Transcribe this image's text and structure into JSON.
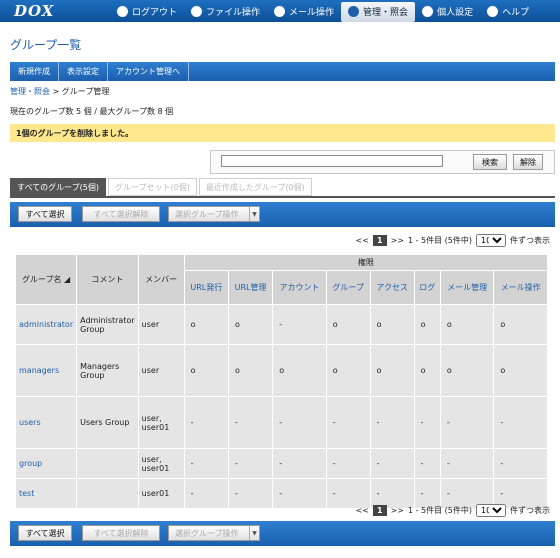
{
  "nav": {
    "logo": "DOX",
    "items": [
      {
        "label": "ログアウト",
        "icon": "logout-icon"
      },
      {
        "label": "ファイル操作",
        "icon": "file-icon"
      },
      {
        "label": "メール操作",
        "icon": "mail-icon"
      },
      {
        "label": "管理・照会",
        "icon": "admin-icon"
      },
      {
        "label": "個人設定",
        "icon": "user-icon"
      },
      {
        "label": "ヘルプ",
        "icon": "help-icon"
      }
    ],
    "active_index": 3
  },
  "page_title": "グループ一覧",
  "actions": [
    "新規作成",
    "表示設定",
    "アカウント管理へ"
  ],
  "breadcrumb": {
    "link": "管理・照会",
    "sep": " > ",
    "current": "グループ管理"
  },
  "count_line": "現在のグループ数 5 個 / 最大グループ数 8 個",
  "notice": "1個のグループを削除しました。",
  "filter": {
    "value": "",
    "search_label": "検索",
    "clear_label": "解除"
  },
  "tabs": [
    "すべてのグループ(5個)",
    "グループセット(0個)",
    "最近作成したグループ(0個)"
  ],
  "toolbar": {
    "select_all": "すべて選択",
    "deselect_all": "すべて選択解除",
    "group_op": "選択グループ操作"
  },
  "pager": {
    "prev": "<<",
    "current": "1",
    "next": ">>",
    "range": "1 - 5件目 (5件中)",
    "per_page": "10",
    "suffix": "件ずつ表示"
  },
  "table": {
    "headers": {
      "group": "グループ名",
      "comment": "コメント",
      "members": "メンバー",
      "perm_group": "権限"
    },
    "perm_headers": [
      "URL発行",
      "URL管理",
      "アカウント",
      "グループ",
      "アクセス",
      "ログ",
      "メール管理",
      "メール操作"
    ],
    "rows": [
      {
        "name": "administrator",
        "comment": "Administrator Group",
        "members": "user",
        "perms": [
          "o",
          "o",
          "-",
          "o",
          "o",
          "o",
          "o",
          "o"
        ]
      },
      {
        "name": "managers",
        "comment": "Managers Group",
        "members": "user",
        "perms": [
          "o",
          "o",
          "o",
          "o",
          "o",
          "o",
          "o",
          "o"
        ]
      },
      {
        "name": "users",
        "comment": "Users Group",
        "members": "user, user01",
        "perms": [
          "-",
          "-",
          "-",
          "-",
          "-",
          "-",
          "-",
          "-"
        ]
      },
      {
        "name": "group",
        "comment": "",
        "members": "user, user01",
        "perms": [
          "-",
          "-",
          "-",
          "-",
          "-",
          "-",
          "-",
          "-"
        ]
      },
      {
        "name": "test",
        "comment": "",
        "members": "user01",
        "perms": [
          "-",
          "-",
          "-",
          "-",
          "-",
          "-",
          "-",
          "-"
        ]
      }
    ]
  }
}
